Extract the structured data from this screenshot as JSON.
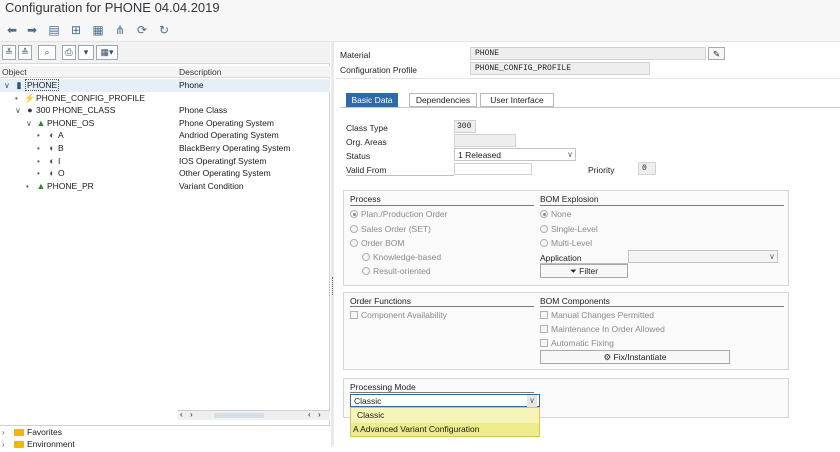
{
  "window": {
    "title": "Configuration for PHONE 04.04.2019"
  },
  "toolbar": {
    "icons": [
      "arrow-left-icon",
      "arrow-right-icon",
      "display-list-icon",
      "hierarchy-icon",
      "table-icon",
      "tree-icon",
      "refresh-icon"
    ]
  },
  "left_panel": {
    "columns": {
      "object": "Object",
      "description": "Description"
    },
    "tree": [
      {
        "indent": 0,
        "toggle": "∨",
        "icon": "▮",
        "label": "PHONE",
        "desc": "Phone",
        "selected": true
      },
      {
        "indent": 1,
        "toggle": "•",
        "icon": "⚡",
        "label": "PHONE_CONFIG_PROFILE",
        "desc": ""
      },
      {
        "indent": 1,
        "toggle": "∨",
        "icon": "●",
        "label": "300 PHONE_CLASS",
        "desc": "Phone Class"
      },
      {
        "indent": 2,
        "toggle": "∨",
        "icon": "▲",
        "label": "PHONE_OS",
        "desc": "Phone Operating System"
      },
      {
        "indent": 3,
        "toggle": "•",
        "icon": "◐",
        "label": "A",
        "desc": "Andriod Operating System"
      },
      {
        "indent": 3,
        "toggle": "•",
        "icon": "◐",
        "label": "B",
        "desc": "BlackBerry Operating System"
      },
      {
        "indent": 3,
        "toggle": "•",
        "icon": "◐",
        "label": "I",
        "desc": "IOS Operatingf System"
      },
      {
        "indent": 3,
        "toggle": "•",
        "icon": "◐",
        "label": "O",
        "desc": "Other Operating System"
      },
      {
        "indent": 2,
        "toggle": "•",
        "icon": "▲",
        "label": "PHONE_PR",
        "desc": "Variant Condition"
      }
    ],
    "bottom_items": [
      "Favorites",
      "Environment"
    ]
  },
  "header_fields": {
    "material_label": "Material",
    "material_value": "PHONE",
    "profile_label": "Configuration Profile",
    "profile_value": "PHONE_CONFIG_PROFILE"
  },
  "tabs": [
    "Basic Data",
    "Dependencies",
    "User Interface"
  ],
  "basic_data": {
    "class_type_label": "Class Type",
    "class_type_value": "300",
    "org_areas_label": "Org. Areas",
    "status_label": "Status",
    "status_value": "1 Released",
    "valid_from_label": "Valid From",
    "priority_label": "Priority",
    "priority_value": "0"
  },
  "process": {
    "title": "Process",
    "options": [
      "Plan./Production Order",
      "Sales Order (SET)",
      "Order BOM"
    ],
    "sub_options": [
      "Knowledge-based",
      "Result-oriented"
    ]
  },
  "bom_explosion": {
    "title": "BOM Explosion",
    "options": [
      "None",
      "Single-Level",
      "Multi-Level"
    ],
    "application_label": "Application",
    "filter_button": "Filter"
  },
  "order_functions": {
    "title": "Order Functions",
    "component_availability": "Component Availability"
  },
  "bom_components": {
    "title": "BOM Components",
    "checkboxes": [
      "Manual Changes Permitted",
      "Maintenance In Order Allowed",
      "Automatic Fixing"
    ],
    "fix_button": "Fix/Instantiate"
  },
  "processing_mode": {
    "title": "Processing Mode",
    "selected": "Classic",
    "options": [
      "Classic",
      "A Advanced Variant Configuration"
    ]
  },
  "colors": {
    "active_tab": "#2d6aa6",
    "dropdown_menu": "#f7f4b8",
    "folder": "#f2b705",
    "class_type_icon": "#2a8a2a"
  }
}
